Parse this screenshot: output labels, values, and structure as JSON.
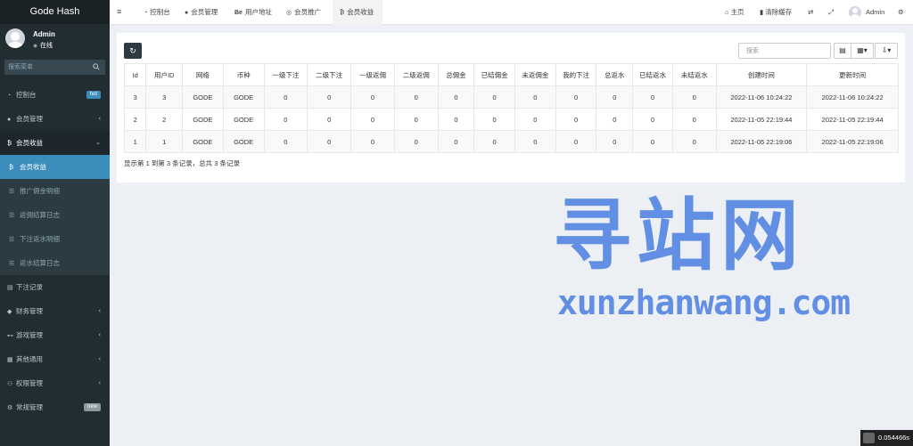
{
  "app": {
    "title": "Gode Hash"
  },
  "user": {
    "name": "Admin",
    "status": "在线"
  },
  "sidebar": {
    "search_placeholder": "搜索菜单",
    "items": [
      {
        "label": "控制台",
        "icon": "dashboard-icon",
        "badge": "hot"
      },
      {
        "label": "会员管理",
        "icon": "user-circle-icon"
      },
      {
        "label": "会员收益",
        "icon": "bitcoin-icon",
        "open": true,
        "children": [
          {
            "label": "会员收益",
            "icon": "bitcoin-icon",
            "active": true
          },
          {
            "label": "推广佣金明细",
            "icon": "list-icon"
          },
          {
            "label": "返佣结算日志",
            "icon": "list-icon"
          },
          {
            "label": "下注返水明细",
            "icon": "list-icon"
          },
          {
            "label": "返水结算日志",
            "icon": "list-icon"
          }
        ]
      },
      {
        "label": "下注记录",
        "icon": "file-icon"
      },
      {
        "label": "财务管理",
        "icon": "diamond-icon"
      },
      {
        "label": "游戏管理",
        "icon": "gamepad-icon"
      },
      {
        "label": "其他通用",
        "icon": "grid-icon"
      },
      {
        "label": "权限管理",
        "icon": "group-icon"
      },
      {
        "label": "常规管理",
        "icon": "cogs-icon",
        "badge": "new"
      }
    ]
  },
  "topnav": {
    "tabs": [
      {
        "label": "控制台",
        "icon": "dashboard-icon"
      },
      {
        "label": "会员管理",
        "icon": "user-icon"
      },
      {
        "label": "用户地址",
        "icon": "behance-icon",
        "icon_text": "Be"
      },
      {
        "label": "会员推广",
        "icon": "eye-icon"
      },
      {
        "label": "会员收益",
        "icon": "bitcoin-icon",
        "active": true
      }
    ],
    "home_label": "主页",
    "clear_cache_label": "清除缓存",
    "user_name": "Admin"
  },
  "table": {
    "search_placeholder": "搜索",
    "columns": [
      "Id",
      "用户ID",
      "网络",
      "币种",
      "一级下注",
      "二级下注",
      "一级返佣",
      "二级返佣",
      "总佣金",
      "已结佣金",
      "未返佣金",
      "我的下注",
      "总返水",
      "已结返水",
      "未结返水",
      "创建时间",
      "更新时间"
    ],
    "rows": [
      [
        "3",
        "3",
        "GODE",
        "GODE",
        "0",
        "0",
        "0",
        "0",
        "0",
        "0",
        "0",
        "0",
        "0",
        "0",
        "0",
        "2022-11-06 10:24:22",
        "2022-11-06 10:24:22"
      ],
      [
        "2",
        "2",
        "GODE",
        "GODE",
        "0",
        "0",
        "0",
        "0",
        "0",
        "0",
        "0",
        "0",
        "0",
        "0",
        "0",
        "2022-11-05 22:19:44",
        "2022-11-05 22:19:44"
      ],
      [
        "1",
        "1",
        "GODE",
        "GODE",
        "0",
        "0",
        "0",
        "0",
        "0",
        "0",
        "0",
        "0",
        "0",
        "0",
        "0",
        "2022-11-05 22:19:06",
        "2022-11-05 22:19:06"
      ]
    ],
    "footer": "显示第 1 到第 3 条记录，总共 3 条记录"
  },
  "watermark": {
    "cn": "寻站网",
    "en": "xunzhanwang.com"
  },
  "timer": "0.054466s",
  "colors": {
    "sidebar_bg": "#222d32",
    "active_blue": "#3c8dbc",
    "watermark": "#4a7fe0"
  }
}
